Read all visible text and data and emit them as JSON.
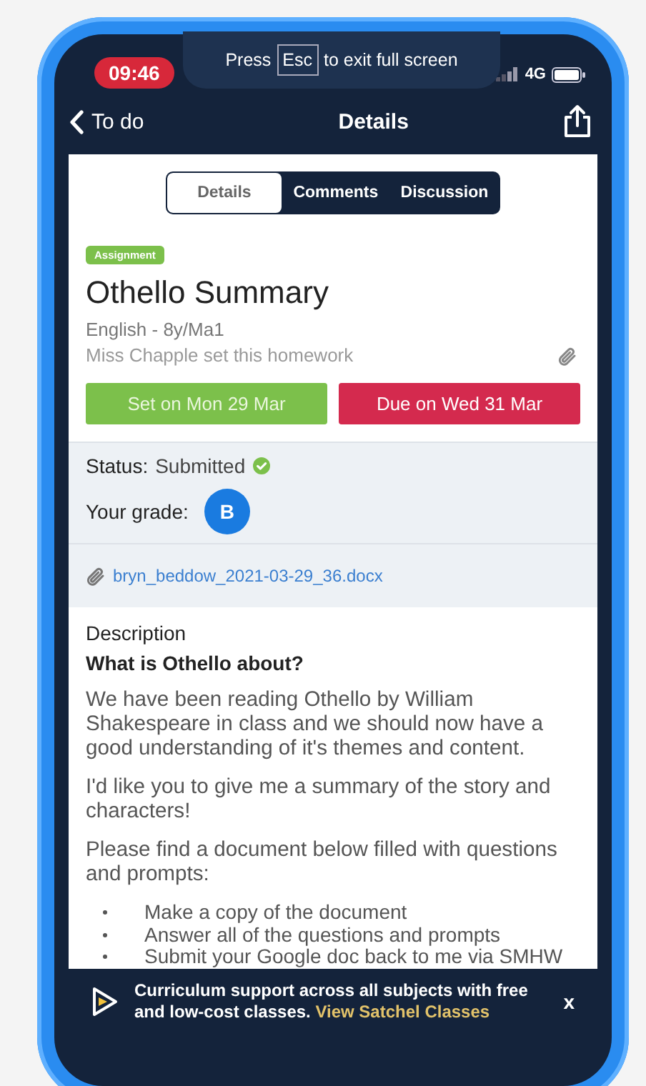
{
  "fullscreen_hint": {
    "before": "Press",
    "key": "Esc",
    "after": "to exit full screen"
  },
  "status_bar": {
    "time": "09:46",
    "network": "4G"
  },
  "nav": {
    "back": "To do",
    "title": "Details"
  },
  "tabs": [
    {
      "label": "Details",
      "selected": true
    },
    {
      "label": "Comments",
      "selected": false
    },
    {
      "label": "Discussion",
      "selected": false
    }
  ],
  "assignment": {
    "badge": "Assignment",
    "title": "Othello Summary",
    "subject": "English - 8y/Ma1",
    "teacher": "Miss Chapple set this homework",
    "set_date": "Set on Mon 29 Mar",
    "due_date": "Due on Wed 31 Mar"
  },
  "submission": {
    "status_label": "Status:",
    "status": "Submitted",
    "grade_label": "Your grade:",
    "grade": "B",
    "attachment": "bryn_beddow_2021-03-29_36.docx"
  },
  "description": {
    "heading": "Description",
    "subheading": "What is Othello about?",
    "paragraphs": [
      "We have been reading Othello by William Shakespeare in class and we should now have a good understanding of it's themes and content.",
      "I'd like you to give me a summary of the story and characters!",
      "Please find a document below filled with questions and prompts:"
    ],
    "bullets": [
      "Make a copy of the document",
      "Answer all of the questions and prompts",
      "Submit your Google doc back to me via SMHW"
    ]
  },
  "banner": {
    "text": "Curriculum support across all subjects with free and low-cost classes.",
    "link": "View Satchel Classes",
    "close": "x"
  }
}
